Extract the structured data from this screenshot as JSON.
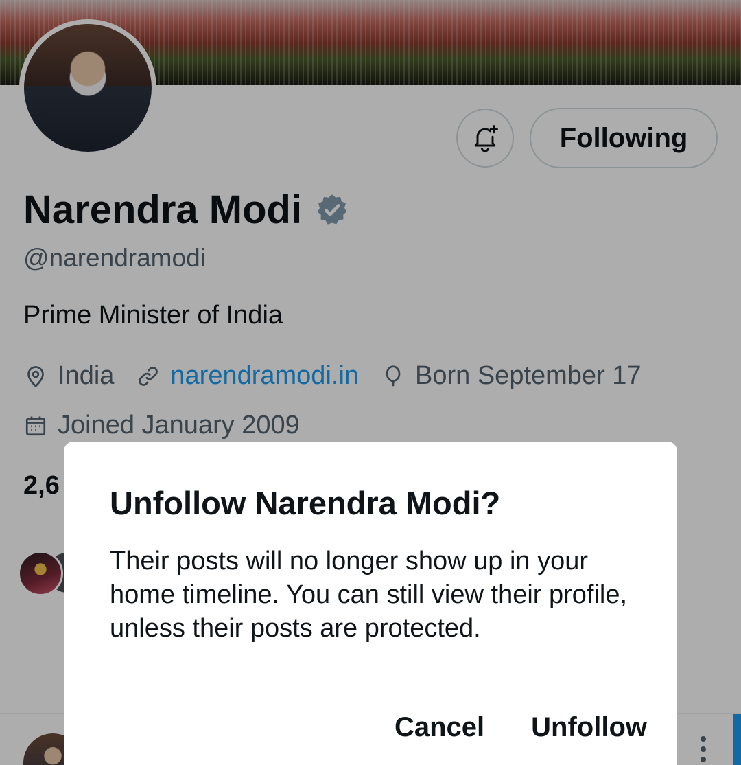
{
  "profile": {
    "name": "Narendra Modi",
    "handle": "@narendramodi",
    "bio": "Prime Minister of India",
    "location": "India",
    "website": "narendramodi.in",
    "birthday": "Born September 17",
    "joined": "Joined January 2009",
    "following_count_partial": "2,6",
    "verified_icon": "verified-badge-icon"
  },
  "header": {
    "notify_icon": "bell-plus-icon",
    "following_label": "Following"
  },
  "dialog": {
    "title": "Unfollow Narendra Modi?",
    "body": "Their posts will no longer show up in your home timeline. You can still view their profile, unless their posts are protected.",
    "cancel_label": "Cancel",
    "confirm_label": "Unfollow"
  },
  "colors": {
    "accent": "#1d9bf0",
    "text_primary": "#0f1419",
    "text_secondary": "#536471",
    "border": "#cfd9de",
    "verified_gray": "#829aab"
  }
}
